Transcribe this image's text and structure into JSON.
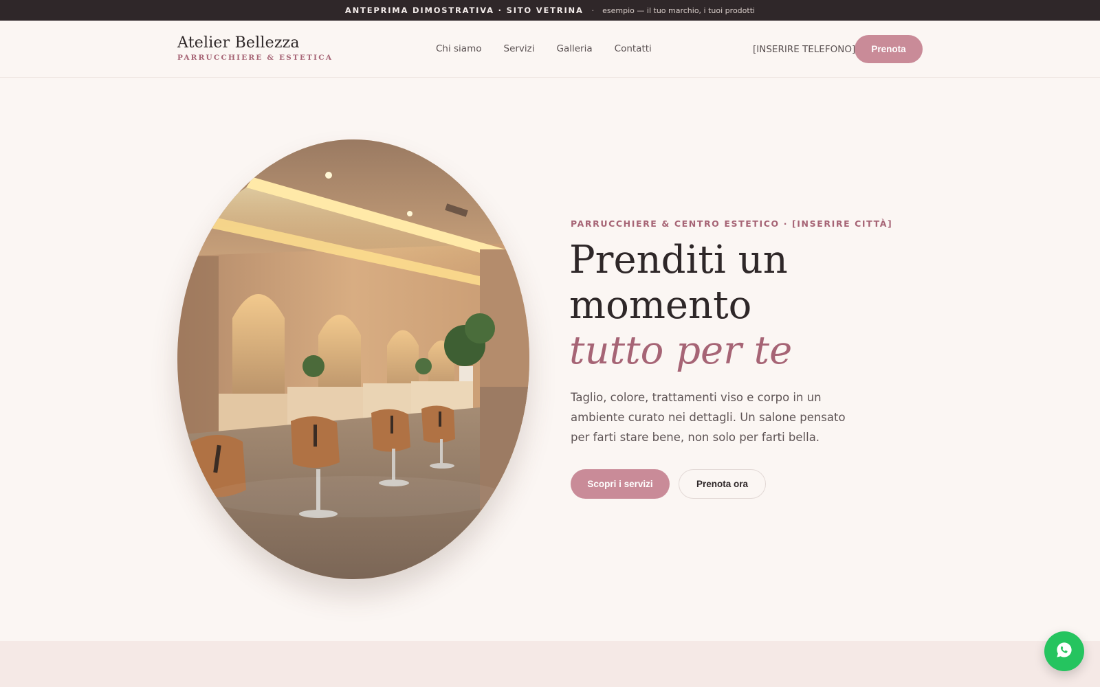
{
  "announcement": {
    "strong": "ANTEPRIMA DIMOSTRATIVA · SITO VETRINA",
    "separator": "·",
    "note": "esempio — il tuo marchio, i tuoi prodotti"
  },
  "header": {
    "logo_title": "Atelier Bellezza",
    "logo_subtitle": "PARRUCCHIERE & ESTETICA",
    "nav": [
      "Chi siamo",
      "Servizi",
      "Galleria",
      "Contatti"
    ],
    "phone": "[INSERIRE TELEFONO]",
    "cta": "Prenota"
  },
  "hero": {
    "eyebrow": "PARRUCCHIERE & CENTRO ESTETICO · [INSERIRE CITTÀ]",
    "headline_line1": "Prenditi un",
    "headline_line2": "momento",
    "headline_accent": "tutto per te",
    "lead": "Taglio, colore, trattamenti viso e corpo in un ambiente curato nei dettagli. Un salone pensato per farti stare bene, non solo per farti bella.",
    "primary_cta": "Scopri i servizi",
    "secondary_cta": "Prenota ora"
  },
  "colors": {
    "accent": "#a66475",
    "button": "#c98b98",
    "background": "#fbf6f3",
    "topbar": "#2f2729",
    "whatsapp": "#25c45f"
  },
  "icons": {
    "floating": "whatsapp-icon"
  }
}
